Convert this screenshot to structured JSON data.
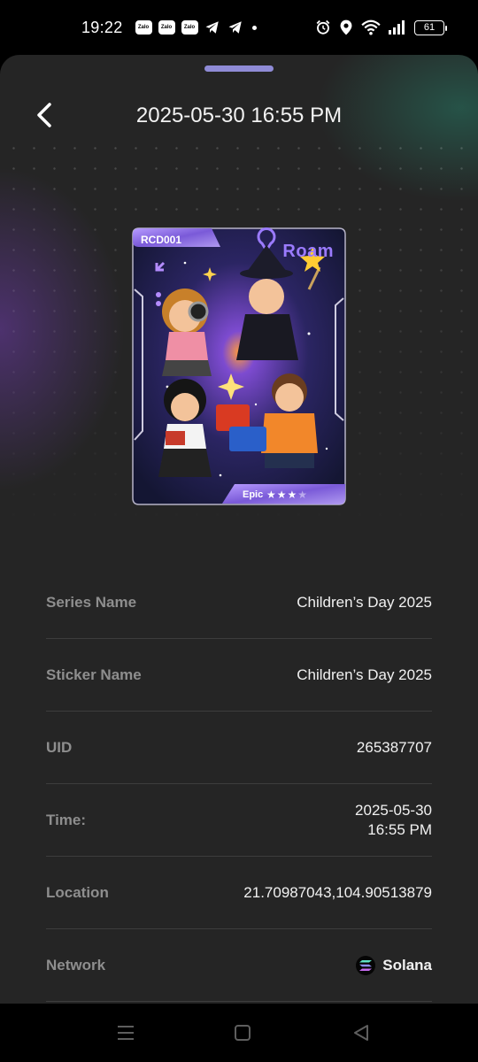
{
  "status_bar": {
    "time": "19:22",
    "app_badges": [
      "Zalo",
      "Zalo",
      "Zalo"
    ],
    "battery": "61",
    "icons": [
      "telegram-icon",
      "telegram-icon",
      "alarm-icon",
      "location-icon",
      "wifi-icon",
      "signal-icon",
      "battery-icon"
    ]
  },
  "header": {
    "title": "2025-05-30 16:55 PM",
    "back_icon": "chevron-left-icon"
  },
  "card": {
    "code": "RCD001",
    "brand": "Roam",
    "rarity": "Epic",
    "stars": 3,
    "stars_max": 4,
    "colors": {
      "frame": "#9a7cf0",
      "accent": "#a07dfa",
      "background": "#1d1840"
    }
  },
  "details": {
    "series_name": {
      "label": "Series Name",
      "value": "Children’s Day 2025"
    },
    "sticker_name": {
      "label": "Sticker Name",
      "value": "Children’s Day 2025"
    },
    "uid": {
      "label": "UID",
      "value": "265387707"
    },
    "time": {
      "label": "Time:",
      "value_date": "2025-05-30",
      "value_time": "16:55 PM"
    },
    "location": {
      "label": "Location",
      "value": "21.70987043,104.90513879"
    },
    "network": {
      "label": "Network",
      "value": "Solana",
      "icon": "solana-icon"
    }
  },
  "nav": {
    "icons": [
      "menu-icon",
      "home-square-icon",
      "back-triangle-icon"
    ]
  }
}
